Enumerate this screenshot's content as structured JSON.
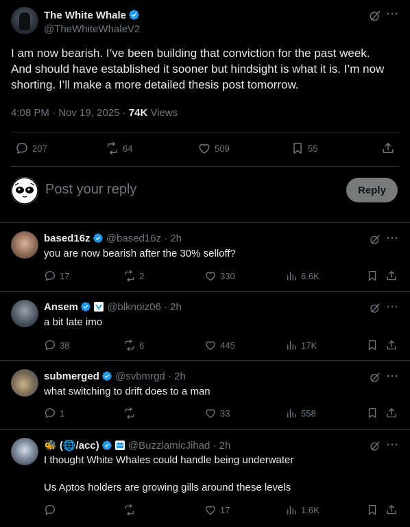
{
  "main_post": {
    "author_name": "The White Whale",
    "author_handle": "@TheWhiteWhaleV2",
    "text_lines": [
      "I am now bearish. I’ve been building that conviction for the past week.",
      "And should have established it sooner but hindsight is what it is. I’m now",
      "shorting. I’ll make a more detailed thesis post tomorrow."
    ],
    "timestamp": "4:08 PM · Nov 19, 2025 · ",
    "views_count": "74K",
    "views_label": " Views",
    "replies": "207",
    "reposts": "64",
    "likes": "509",
    "bookmarks": "55"
  },
  "composer": {
    "placeholder": "Post your reply",
    "button_label": "Reply"
  },
  "replies": [
    {
      "name": "based16z",
      "handle": "@based16z",
      "time": "· 2h",
      "lines": [
        "you are now bearish after the 30% selloff?"
      ],
      "replies": "17",
      "reposts": "2",
      "likes": "330",
      "views": "6.6K"
    },
    {
      "name": "Ansem",
      "handle": "@blknoiz06",
      "time": "· 2h",
      "lines": [
        "a bit late imo"
      ],
      "replies": "38",
      "reposts": "6",
      "likes": "445",
      "views": "17K"
    },
    {
      "name": "submerged",
      "handle": "@svbmrgd",
      "time": "· 2h",
      "lines": [
        "what switching to drift does to a man"
      ],
      "replies": "1",
      "reposts": "",
      "likes": "33",
      "views": "558"
    },
    {
      "name": "(🌐/acc)",
      "name_prefix_emoji": "🐝",
      "handle": "@BuzzlamicJihad",
      "time": "· 2h",
      "lines": [
        "I thought White Whales could handle being underwater",
        "Us Aptos holders are growing gills around these levels"
      ],
      "replies": "",
      "reposts": "",
      "likes": "17",
      "views": "1.6K"
    }
  ],
  "colors": {
    "background": "#000000",
    "text": "#e7e9ea",
    "muted": "#71767b",
    "divider": "#2f3336",
    "verified": "#1d9bf0",
    "reply_button": "#787a7a"
  },
  "icons": [
    "grok-icon",
    "more-icon",
    "reply-icon",
    "repost-icon",
    "like-icon",
    "bookmark-icon",
    "share-icon",
    "views-icon",
    "verified-badge-icon",
    "affiliate-badge-icon"
  ]
}
